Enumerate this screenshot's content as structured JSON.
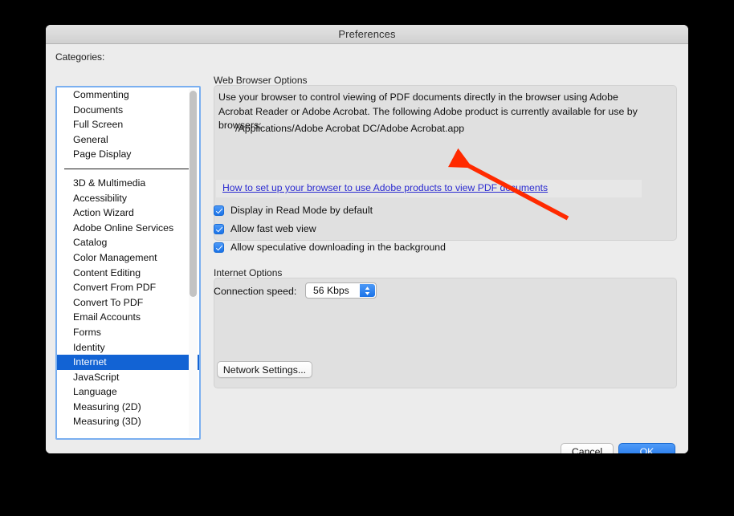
{
  "window": {
    "title": "Preferences"
  },
  "categories": {
    "label": "Categories:",
    "group_one": [
      "Commenting",
      "Documents",
      "Full Screen",
      "General",
      "Page Display"
    ],
    "group_two": [
      "3D & Multimedia",
      "Accessibility",
      "Action Wizard",
      "Adobe Online Services",
      "Catalog",
      "Color Management",
      "Content Editing",
      "Convert From PDF",
      "Convert To PDF",
      "Email Accounts",
      "Forms",
      "Identity",
      "Internet",
      "JavaScript",
      "Language",
      "Measuring (2D)",
      "Measuring (3D)"
    ],
    "selected": "Internet"
  },
  "web_browser_options": {
    "title": "Web Browser Options",
    "description": "Use your browser to control viewing of PDF documents directly in the browser using Adobe Acrobat Reader or Adobe Acrobat. The following Adobe product is currently available for use by browsers:",
    "product_path": "/Applications/Adobe Acrobat DC/Adobe Acrobat.app",
    "help_link": "How to set up your browser to use Adobe products to view PDF documents",
    "checkboxes": [
      {
        "label": "Display in Read Mode by default",
        "checked": true
      },
      {
        "label": "Allow fast web view",
        "checked": true
      },
      {
        "label": "Allow speculative downloading in the background",
        "checked": true
      }
    ]
  },
  "internet_options": {
    "title": "Internet Options",
    "connection_speed_label": "Connection speed:",
    "connection_speed_value": "56 Kbps",
    "network_settings_button": "Network Settings..."
  },
  "footer": {
    "cancel_label": "Cancel",
    "ok_label": "OK"
  },
  "annotation": {
    "arrow_color": "#FF2A00"
  },
  "colors": {
    "selection_blue": "#1263D4",
    "link_blue": "#2B2BD0",
    "accent_blue": "#1A72E8",
    "window_bg": "#ECECEC",
    "groupbox_bg": "#E0E0E0"
  }
}
